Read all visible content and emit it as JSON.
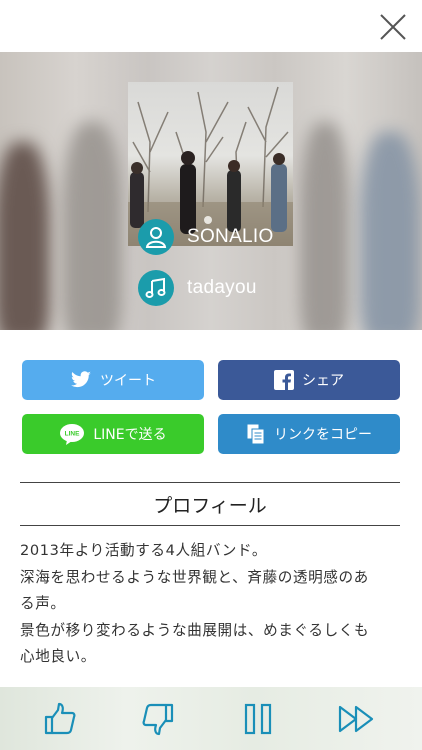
{
  "artist": {
    "name": "SONALIO",
    "song": "tadayou",
    "photo_alt": "band photo"
  },
  "share": {
    "tweet_label": "ツイート",
    "facebook_label": "シェア",
    "line_label": "LINEで送る",
    "line_icon_text": "LINE",
    "copy_label": "リンクをコピー"
  },
  "profile": {
    "title": "プロフィール",
    "lines": [
      "2013年より活動する4人組バンド。",
      "深海を思わせるような世界観と、斉藤の透明感のあ",
      "る声。",
      "景色が移り変わるような曲展開は、めまぐるしくも",
      "心地良い。"
    ]
  },
  "colors": {
    "twitter": "#55acee",
    "facebook": "#3b5998",
    "line": "#3acb2b",
    "copy": "#2f8bc9",
    "accent": "#1b9cab",
    "player_icon": "#1a8fb8"
  },
  "icons": {
    "close": "close-icon",
    "user": "user-icon",
    "music": "music-note-icon",
    "twitter": "twitter-bird-icon",
    "facebook": "facebook-icon",
    "line": "line-icon",
    "copy": "copy-icon",
    "like": "thumbs-up-icon",
    "dislike": "thumbs-down-icon",
    "pause": "pause-icon",
    "next": "fast-forward-icon"
  }
}
